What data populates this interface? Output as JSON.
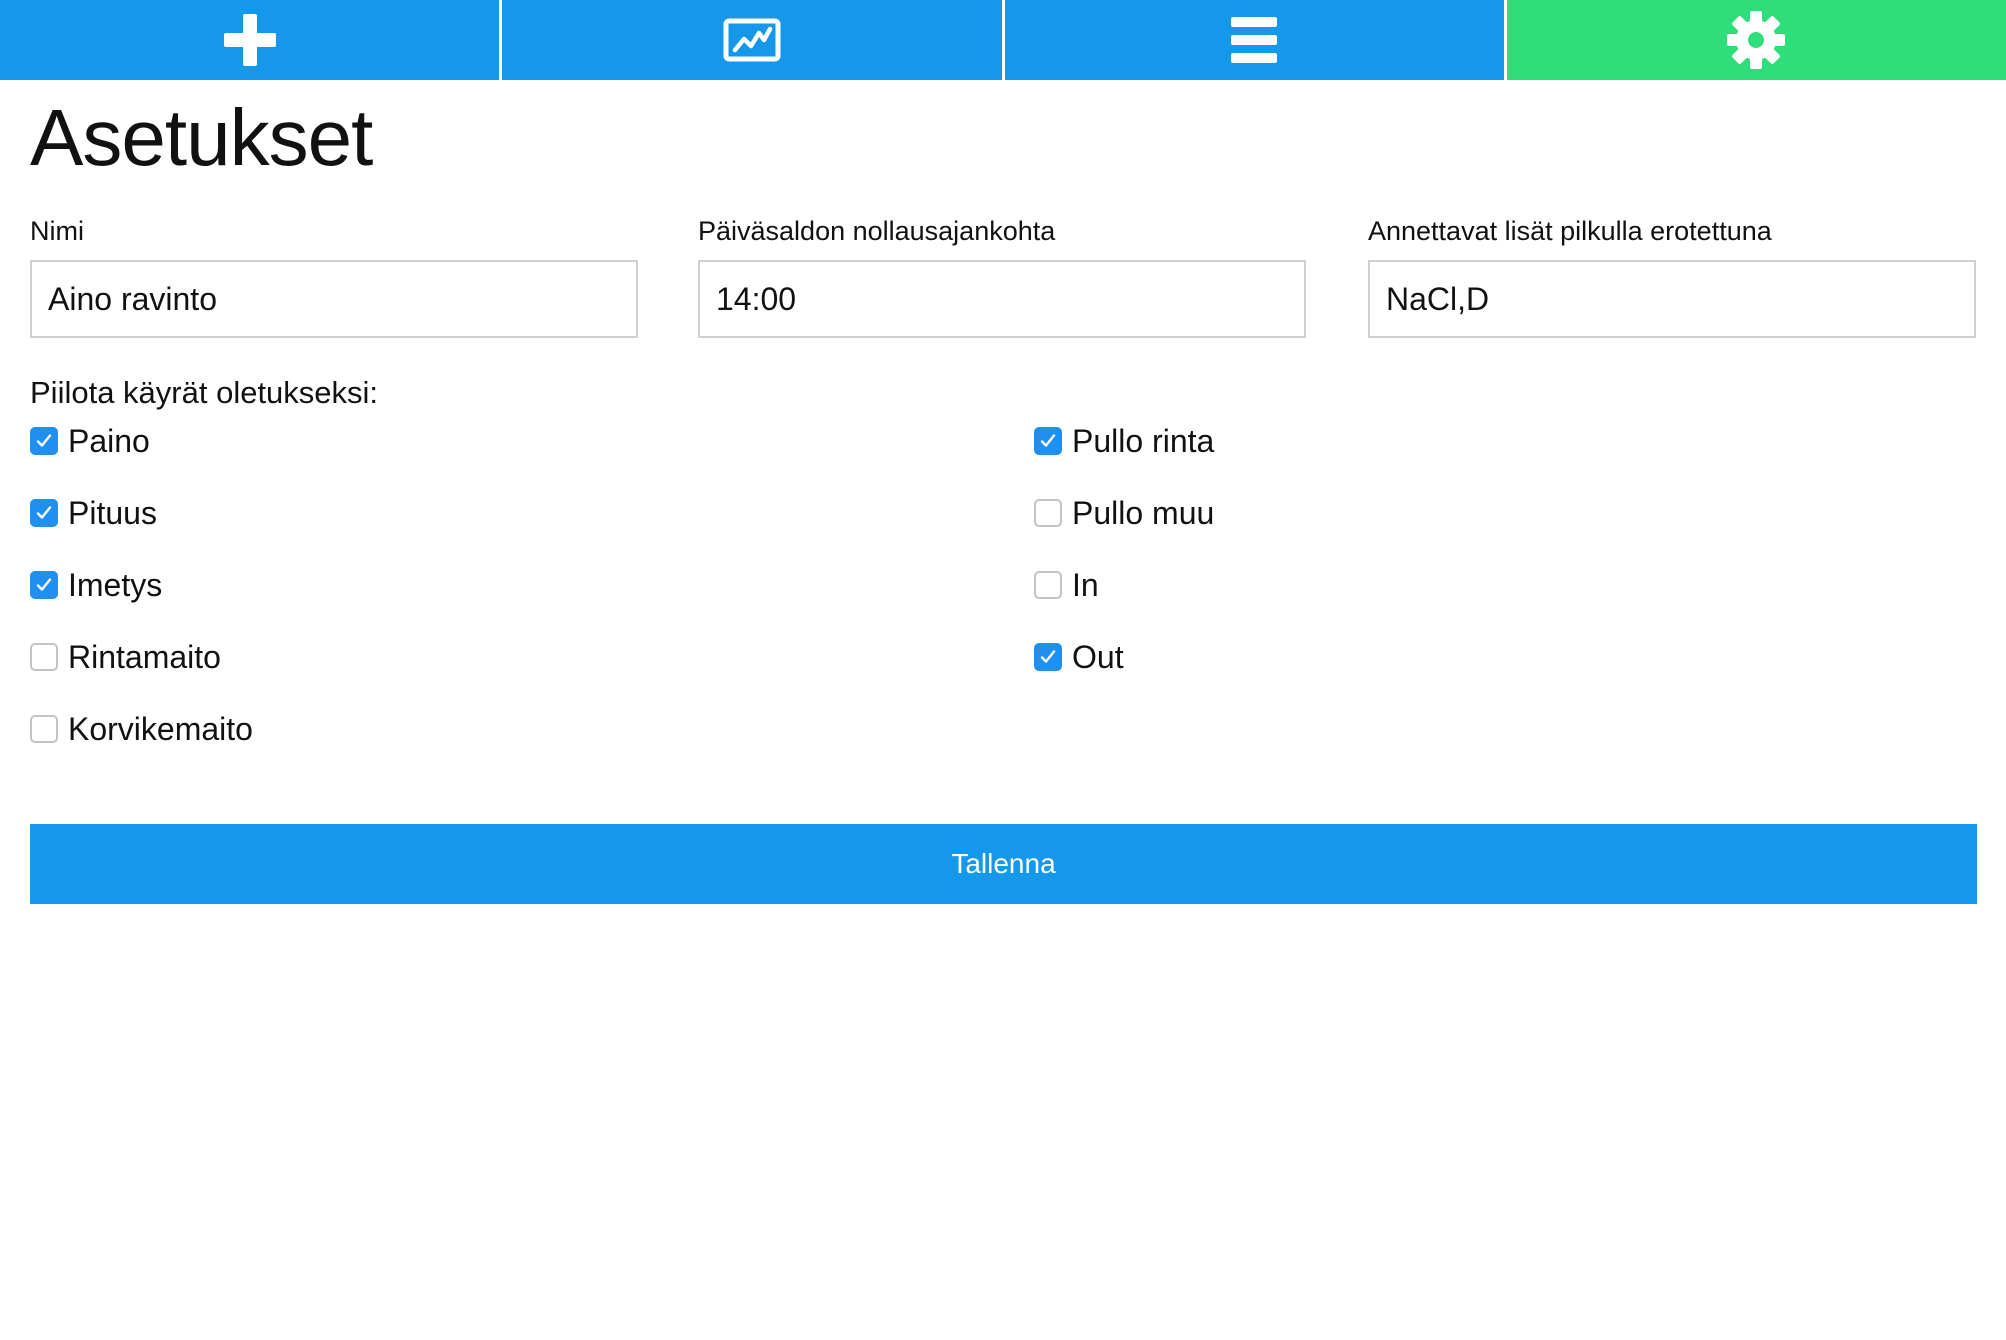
{
  "nav": {
    "tabs": [
      {
        "icon": "plus-icon",
        "active": false
      },
      {
        "icon": "chart-icon",
        "active": false
      },
      {
        "icon": "list-icon",
        "active": false
      },
      {
        "icon": "gear-icon",
        "active": true
      }
    ]
  },
  "colors": {
    "nav_blue": "#1597ea",
    "nav_active_green": "#2fde7a",
    "checkbox_checked": "#1f8ff0",
    "button_blue": "#1597ea"
  },
  "page": {
    "title": "Asetukset"
  },
  "fields": {
    "name": {
      "label": "Nimi",
      "value": "Aino ravinto"
    },
    "reset_time": {
      "label": "Päiväsaldon nollausajankohta",
      "value": "14:00"
    },
    "supplements": {
      "label": "Annettavat lisät pilkulla erotettuna",
      "value": "NaCl,D"
    }
  },
  "hide_curves": {
    "label": "Piilota käyrät oletukseksi:",
    "left": [
      {
        "label": "Paino",
        "checked": true
      },
      {
        "label": "Pituus",
        "checked": true
      },
      {
        "label": "Imetys",
        "checked": true
      },
      {
        "label": "Rintamaito",
        "checked": false
      },
      {
        "label": "Korvikemaito",
        "checked": false
      }
    ],
    "right": [
      {
        "label": "Pullo rinta",
        "checked": true
      },
      {
        "label": "Pullo muu",
        "checked": false
      },
      {
        "label": "In",
        "checked": false
      },
      {
        "label": "Out",
        "checked": true
      }
    ]
  },
  "actions": {
    "save_label": "Tallenna"
  }
}
